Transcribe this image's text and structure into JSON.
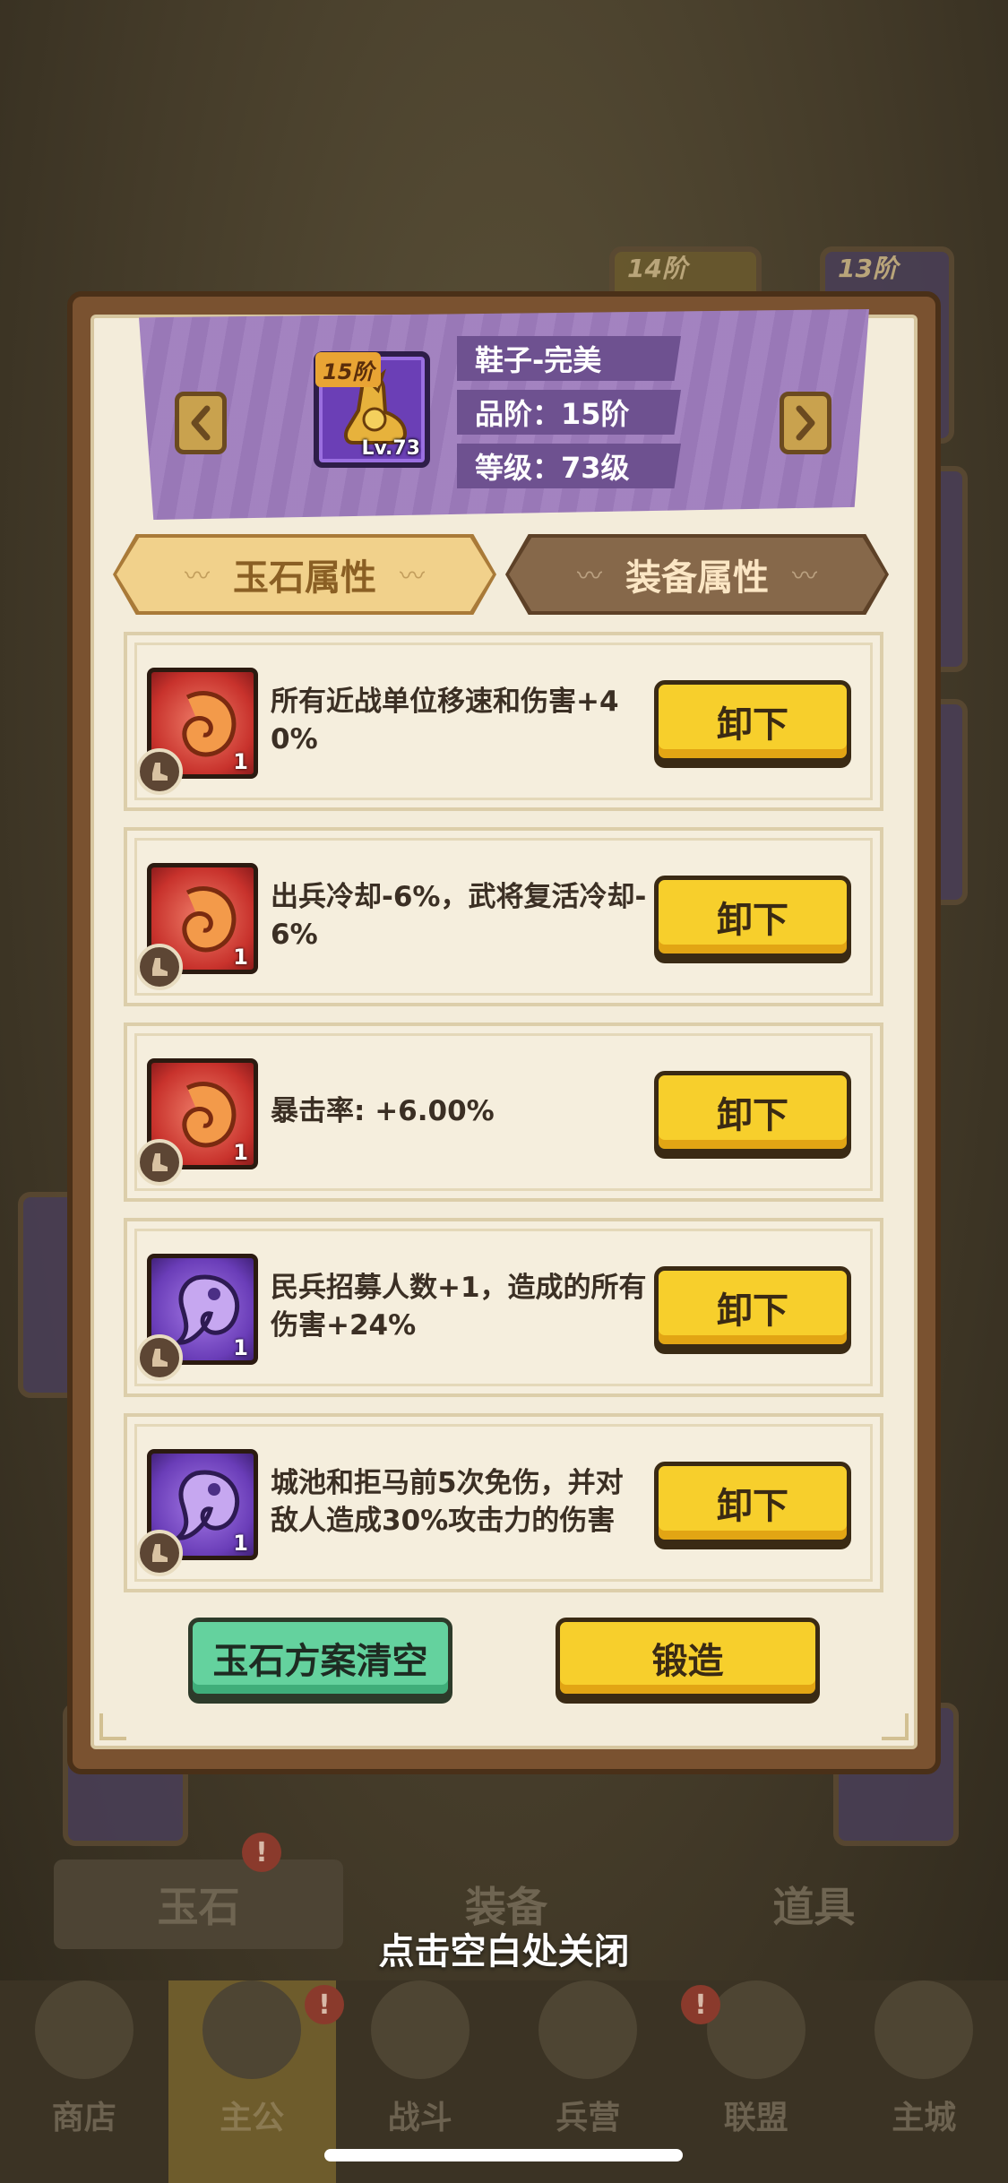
{
  "background": {
    "tier_labels": [
      "14阶",
      "13阶"
    ],
    "tabs": [
      "玉石",
      "装备",
      "道具"
    ],
    "nav": [
      "商店",
      "主公",
      "战斗",
      "兵营",
      "联盟",
      "主城"
    ],
    "badge_mark": "!"
  },
  "equipment": {
    "name": "鞋子-完美",
    "quality": "品阶：15阶",
    "level": "等级：73级",
    "tier_badge": "15阶",
    "level_badge": "Lv.73",
    "prev_icon": "chevron-left-icon",
    "next_icon": "chevron-right-icon"
  },
  "tabs": {
    "jade": "玉石属性",
    "equip": "装备属性",
    "active": "jade"
  },
  "jade_slots": [
    {
      "gem": "red",
      "count": "1",
      "text": "所有近战单位移速和伤害+40%",
      "button": "卸下"
    },
    {
      "gem": "red",
      "count": "1",
      "text": "出兵冷却-6%，武将复活冷却-6%",
      "button": "卸下"
    },
    {
      "gem": "red",
      "count": "1",
      "text": "暴击率: +6.00%",
      "button": "卸下"
    },
    {
      "gem": "purple",
      "count": "1",
      "text": "民兵招募人数+1，造成的所有伤害+24%",
      "button": "卸下"
    },
    {
      "gem": "purple",
      "count": "1",
      "text": "城池和拒马前5次免伤，并对敌人造成30%攻击力的伤害",
      "button": "卸下"
    }
  ],
  "actions": {
    "clear": "玉石方案清空",
    "forge": "锻造"
  },
  "close_hint": "点击空白处关闭",
  "colors": {
    "banner": "#9e7cbd",
    "button_yellow": "#f7cf2c",
    "button_green": "#64d29e",
    "gem_red": "#c8322c",
    "gem_purple": "#6a3db8"
  }
}
